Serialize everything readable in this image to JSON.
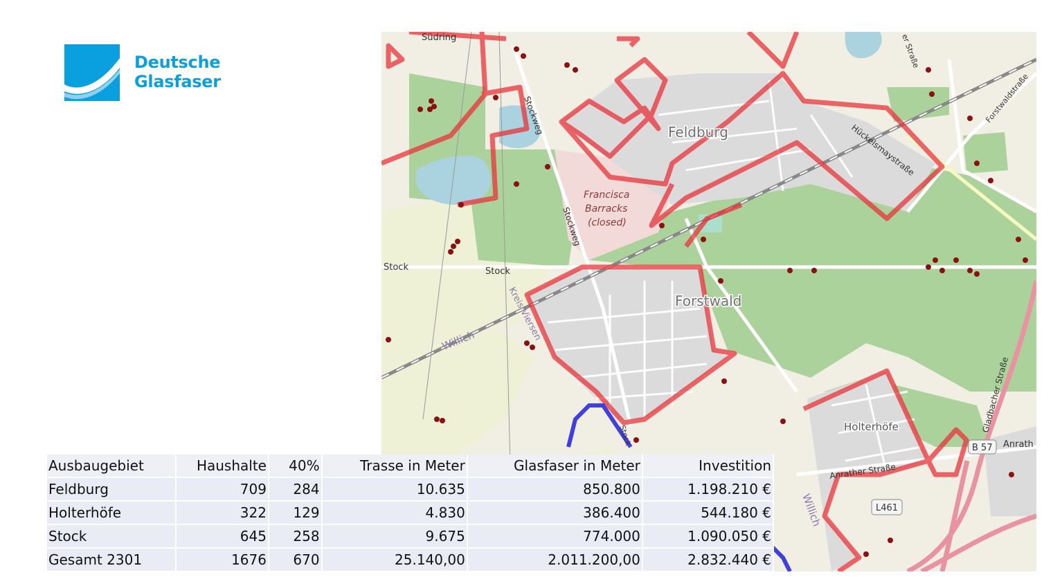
{
  "logo": {
    "line1": "Deutsche",
    "line2": "Glasfaser",
    "color": "#0aa0e0"
  },
  "map": {
    "places": {
      "feldburg": "Feldburg",
      "forstwald": "Forstwald",
      "holterhoefe": "Holterhöfe",
      "francisca1": "Francisca",
      "francisca2": "Barracks",
      "francisca3": "(closed)",
      "willich1": "Willich",
      "willich2": "Willich"
    },
    "streets": {
      "suedring": "Südring",
      "stockweg1": "Stockweg",
      "stockweg2": "Stockweg",
      "stock1": "Stock",
      "stock2": "Stock",
      "kreis_viersen": "Kreis Viersen",
      "hueckelsmay": "Hückelsmaystraße",
      "forstwaldstrasse": "Forstwaldstraße",
      "gladbacher": "Gladbacher Straße",
      "anrather_strasse": "Anrather Straße",
      "anrath": "Anrath",
      "b57": "B 57",
      "l461": "L461",
      "er_strasse": "er Straße",
      "stock_short": "Stock"
    },
    "colors": {
      "area_outline": "#e8343a",
      "route": "#4040e0",
      "forest": "#acd29c",
      "residential": "#dcdbdc",
      "background": "#f1eee4"
    }
  },
  "table": {
    "header": [
      "Ausbaugebiet",
      "Haushalte",
      "40%",
      "Trasse in Meter",
      "Glasfaser in Meter",
      "Investition"
    ],
    "rows": [
      [
        "Feldburg",
        "709",
        "284",
        "10.635",
        "850.800",
        "1.198.210 €"
      ],
      [
        "Holterhöfe",
        "322",
        "129",
        "4.830",
        "386.400",
        "544.180 €"
      ],
      [
        "Stock",
        "645",
        "258",
        "9.675",
        "774.000",
        "1.090.050 €"
      ],
      [
        "Gesamt 2301",
        "1676",
        "670",
        "25.140,00",
        "2.011.200,00",
        "2.832.440 €"
      ]
    ]
  }
}
